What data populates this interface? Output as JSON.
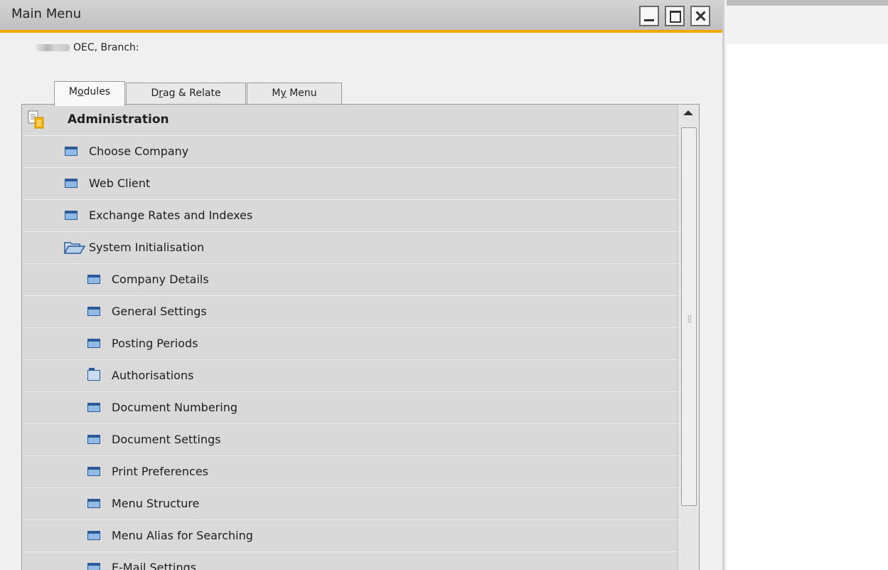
{
  "window": {
    "title": "Main Menu"
  },
  "company_line": "OEC, Branch:",
  "tabs": [
    {
      "label_prefix": "M",
      "label_ul": "o",
      "label_suffix": "dules"
    },
    {
      "label_prefix": "D",
      "label_ul": "r",
      "label_suffix": "ag & Relate"
    },
    {
      "label_prefix": "M",
      "label_ul": "y",
      "label_suffix": " Menu"
    }
  ],
  "menu": {
    "module": "Administration",
    "items": [
      {
        "label": "Choose Company",
        "icon": "window-icon"
      },
      {
        "label": "Web Client",
        "icon": "window-icon"
      },
      {
        "label": "Exchange Rates and Indexes",
        "icon": "window-icon"
      },
      {
        "label": "System Initialisation",
        "icon": "open-folder-icon"
      },
      {
        "label": "Company Details",
        "icon": "window-icon"
      },
      {
        "label": "General Settings",
        "icon": "window-icon"
      },
      {
        "label": "Posting Periods",
        "icon": "window-icon"
      },
      {
        "label": "Authorisations",
        "icon": "folder-icon"
      },
      {
        "label": "Document Numbering",
        "icon": "window-icon"
      },
      {
        "label": "Document Settings",
        "icon": "window-icon"
      },
      {
        "label": "Print Preferences",
        "icon": "window-icon"
      },
      {
        "label": "Menu Structure",
        "icon": "window-icon"
      },
      {
        "label": "Menu Alias for Searching",
        "icon": "window-icon"
      },
      {
        "label": "E-Mail Settings",
        "icon": "window-icon"
      }
    ]
  },
  "colors": {
    "accent": "#f0a800",
    "row_bg": "#d9d9d9",
    "icon_blue": "#2b5a9a"
  }
}
